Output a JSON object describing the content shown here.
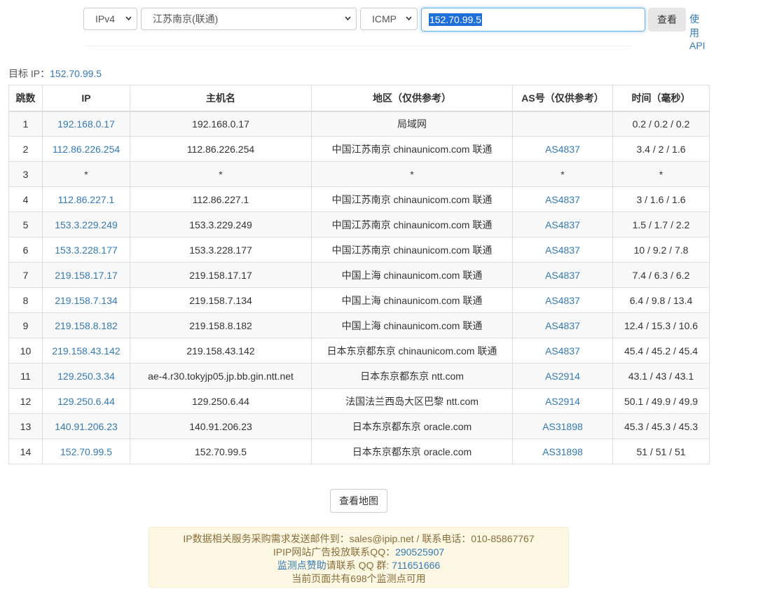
{
  "toolbar": {
    "protocol": "IPv4",
    "node": "江苏南京(联通)",
    "method": "ICMP",
    "target_value": "152.70.99.5",
    "query_label": "查看",
    "api_label": "使用API"
  },
  "target": {
    "label": "目标 IP：",
    "ip": "152.70.99.5"
  },
  "table": {
    "headers": [
      "跳数",
      "IP",
      "主机名",
      "地区（仅供参考）",
      "AS号（仅供参考）",
      "时间（毫秒）"
    ],
    "rows": [
      {
        "hop": "1",
        "ip": "192.168.0.17",
        "host": "192.168.0.17",
        "location": "局域网",
        "as": "",
        "time": "0.2 / 0.2 / 0.2"
      },
      {
        "hop": "2",
        "ip": "112.86.226.254",
        "host": "112.86.226.254",
        "location": "中国江苏南京 chinaunicom.com 联通",
        "as": "AS4837",
        "time": "3.4 / 2 / 1.6"
      },
      {
        "hop": "3",
        "ip": "*",
        "host": "*",
        "location": "*",
        "as": "*",
        "time": "*"
      },
      {
        "hop": "4",
        "ip": "112.86.227.1",
        "host": "112.86.227.1",
        "location": "中国江苏南京 chinaunicom.com 联通",
        "as": "AS4837",
        "time": "3 / 1.6 / 1.6"
      },
      {
        "hop": "5",
        "ip": "153.3.229.249",
        "host": "153.3.229.249",
        "location": "中国江苏南京 chinaunicom.com 联通",
        "as": "AS4837",
        "time": "1.5 / 1.7 / 2.2"
      },
      {
        "hop": "6",
        "ip": "153.3.228.177",
        "host": "153.3.228.177",
        "location": "中国江苏南京 chinaunicom.com 联通",
        "as": "AS4837",
        "time": "10 / 9.2 / 7.8"
      },
      {
        "hop": "7",
        "ip": "219.158.17.17",
        "host": "219.158.17.17",
        "location": "中国上海 chinaunicom.com 联通",
        "as": "AS4837",
        "time": "7.4 / 6.3 / 6.2"
      },
      {
        "hop": "8",
        "ip": "219.158.7.134",
        "host": "219.158.7.134",
        "location": "中国上海 chinaunicom.com 联通",
        "as": "AS4837",
        "time": "6.4 / 9.8 / 13.4"
      },
      {
        "hop": "9",
        "ip": "219.158.8.182",
        "host": "219.158.8.182",
        "location": "中国上海 chinaunicom.com 联通",
        "as": "AS4837",
        "time": "12.4 / 15.3 / 10.6"
      },
      {
        "hop": "10",
        "ip": "219.158.43.142",
        "host": "219.158.43.142",
        "location": "日本东京都东京 chinaunicom.com 联通",
        "as": "AS4837",
        "time": "45.4 / 45.2 / 45.4"
      },
      {
        "hop": "11",
        "ip": "129.250.3.34",
        "host": "ae-4.r30.tokyjp05.jp.bb.gin.ntt.net",
        "location": "日本东京都东京 ntt.com",
        "as": "AS2914",
        "time": "43.1 / 43 / 43.1"
      },
      {
        "hop": "12",
        "ip": "129.250.6.44",
        "host": "129.250.6.44",
        "location": "法国法兰西岛大区巴黎 ntt.com",
        "as": "AS2914",
        "time": "50.1 / 49.9 / 49.9"
      },
      {
        "hop": "13",
        "ip": "140.91.206.23",
        "host": "140.91.206.23",
        "location": "日本东京都东京 oracle.com",
        "as": "AS31898",
        "time": "45.3 / 45.3 / 45.3"
      },
      {
        "hop": "14",
        "ip": "152.70.99.5",
        "host": "152.70.99.5",
        "location": "日本东京都东京 oracle.com",
        "as": "AS31898",
        "time": "51 / 51 / 51"
      }
    ]
  },
  "map_button_label": "查看地图",
  "notice": {
    "line1": "IP数据相关服务采购需求发送邮件到：sales@ipip.net / 联系电话：010-85867767",
    "line2_prefix": "IPIP网站广告投放联系QQ：",
    "line2_qq": "290525907",
    "line3_link": "监测点赞助",
    "line3_suffix": "请联系 QQ 群: ",
    "line3_group": "711651666",
    "line4": "当前页面共有698个监测点可用"
  }
}
